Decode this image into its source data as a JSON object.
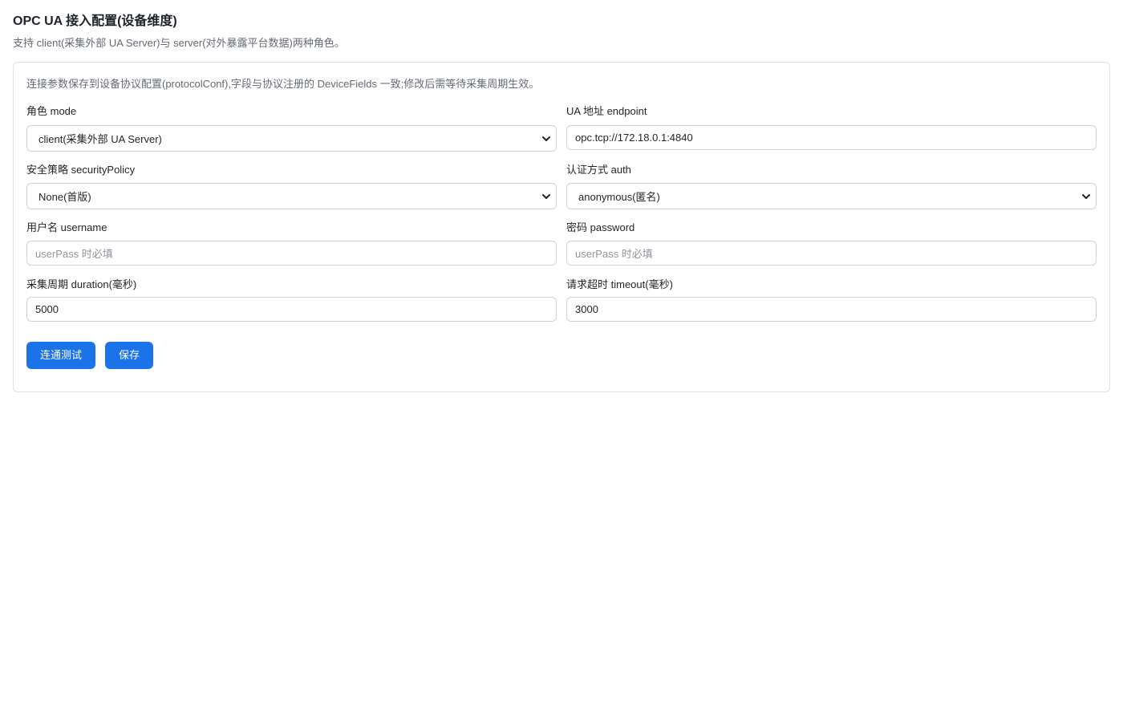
{
  "header": {
    "title": "OPC UA 接入配置(设备维度)",
    "subtitle": "支持 client(采集外部 UA Server)与 server(对外暴露平台数据)两种角色。"
  },
  "card": {
    "hint": "连接参数保存到设备协议配置(protocolConf),字段与协议注册的 DeviceFields 一致;修改后需等待采集周期生效。",
    "mode": {
      "label": "角色 mode",
      "value": "client(采集外部 UA Server)",
      "icon": "chevron-down-icon"
    },
    "endpoint": {
      "label": "UA 地址 endpoint",
      "value": "opc.tcp://172.18.0.1:4840"
    },
    "security_policy": {
      "label": "安全策略 securityPolicy",
      "value": "None(首版)",
      "icon": "chevron-down-icon"
    },
    "auth": {
      "label": "认证方式 auth",
      "value": "anonymous(匿名)",
      "icon": "chevron-down-icon"
    },
    "username": {
      "label": "用户名 username",
      "value": "",
      "placeholder": "userPass 时必填"
    },
    "password": {
      "label": "密码 password",
      "value": "",
      "placeholder": "userPass 时必填"
    },
    "duration": {
      "label": "采集周期 duration(毫秒)",
      "value": "5000"
    },
    "timeout": {
      "label": "请求超时 timeout(毫秒)",
      "value": "3000"
    },
    "buttons": {
      "test_label": "连通测试",
      "save_label": "保存"
    }
  },
  "colors": {
    "primary": "#1a73e8",
    "border": "#d0d3d6",
    "muted_text": "#646a73",
    "placeholder_text": "#8f959e"
  }
}
